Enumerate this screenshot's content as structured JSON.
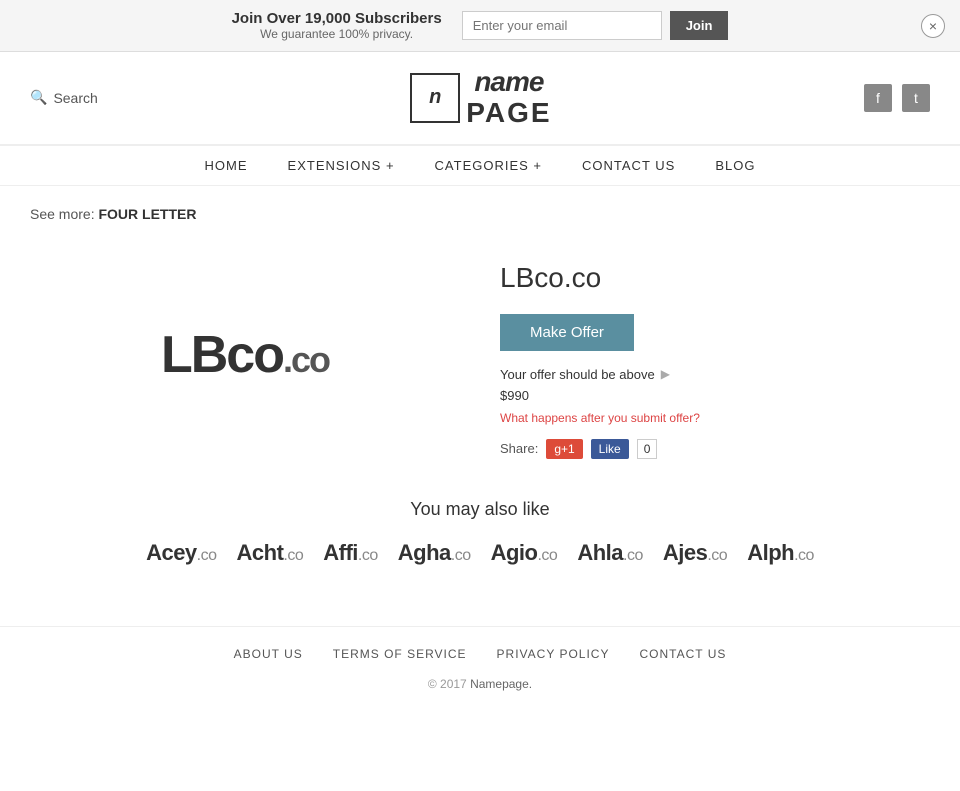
{
  "banner": {
    "title": "Join Over 19,000 Subscribers",
    "subtitle": "We guarantee 100% privacy.",
    "email_placeholder": "Enter your email",
    "join_btn": "Join",
    "close_icon": "×"
  },
  "header": {
    "search_label": "Search",
    "logo_icon": "n",
    "logo_name": "name",
    "logo_page": "PAGE",
    "facebook_icon": "f",
    "twitter_icon": "t"
  },
  "nav": {
    "items": [
      {
        "label": "HOME",
        "id": "home"
      },
      {
        "label": "EXTENSIONS +",
        "id": "extensions"
      },
      {
        "label": "CATEGORIES +",
        "id": "categories"
      },
      {
        "label": "CONTACT  US",
        "id": "contact"
      },
      {
        "label": "BLOG",
        "id": "blog"
      }
    ]
  },
  "see_more": {
    "prefix": "See more:",
    "label": "FOUR LETTER"
  },
  "domain": {
    "logo_main": "LBco",
    "logo_ext": ".co",
    "title": "LBco.co",
    "make_offer_btn": "Make Offer",
    "offer_above_text": "Your offer should be above",
    "offer_price": "$990",
    "offer_link": "What happens after you submit offer?",
    "share_label": "Share:",
    "gplus_label": "g+1",
    "fb_like_label": "Like",
    "fb_count": "0"
  },
  "also_like": {
    "title": "You may also like",
    "items": [
      {
        "name": "Acey",
        "ext": ".co"
      },
      {
        "name": "Acht",
        "ext": ".co"
      },
      {
        "name": "Affi",
        "ext": ".co"
      },
      {
        "name": "Agha",
        "ext": ".co"
      },
      {
        "name": "Agio",
        "ext": ".co"
      },
      {
        "name": "Ahla",
        "ext": ".co"
      },
      {
        "name": "Ajes",
        "ext": ".co"
      },
      {
        "name": "Alph",
        "ext": ".co"
      }
    ]
  },
  "footer": {
    "links": [
      {
        "label": "ABOUT  US"
      },
      {
        "label": "TERMS  OF  SERVICE"
      },
      {
        "label": "PRIVACY  POLICY"
      },
      {
        "label": "CONTACT  US"
      }
    ],
    "copyright": "© 2017",
    "site_name": "Namepage."
  }
}
